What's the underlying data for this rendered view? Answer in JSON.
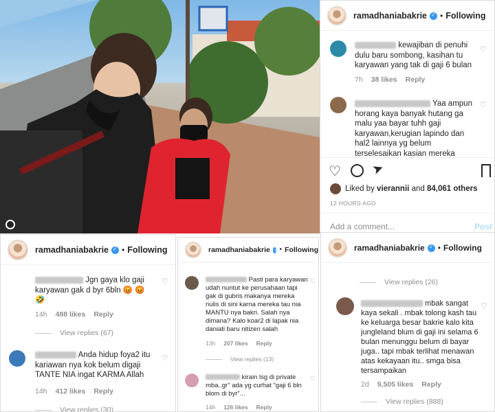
{
  "username": "ramadhaniabakrie",
  "follow_label": "Following",
  "separator": "•",
  "verified_icon": "verified-badge-icon",
  "main": {
    "comments": [
      {
        "text": "kewajiban di penuhi dulu baru sombong, kasihan tu karyawan yang tak di gaji 6 bulan",
        "time": "7h",
        "likes": "38 likes",
        "reply": "Reply"
      },
      {
        "text": "Yaa ampun horang kaya banyak hutang ga malu yaa bayar tuhh gaji karyawan,kerugian lapindo dan hal2 lainnya yg belum terselesaikan kasian mereka"
      }
    ],
    "liked_prefix": "Liked by",
    "liked_user": "vierannii",
    "liked_and": "and",
    "liked_count": "84,061 others",
    "timestamp": "12 HOURS AGO",
    "add_comment_placeholder": "Add a comment...",
    "post_label": "Post"
  },
  "panel_left": {
    "comments": [
      {
        "text": "Jgn gaya klo gaji karyawan gak d byr 6bln 😡",
        "time": "14h",
        "likes": "488 likes",
        "reply": "Reply",
        "view_replies": "View replies (67)"
      },
      {
        "text": "Anda hidup foya2 itu kariawan nya kok belum digaji TANTE NIA ingat KARMA Allah",
        "time": "14h",
        "likes": "412 likes",
        "reply": "Reply",
        "view_replies": "View replies (30)"
      }
    ]
  },
  "panel_mid": {
    "comments": [
      {
        "text": "Pasti para karyawan udah nuntut ke perusahaan tapi gak di gubris makanya mereka nulis di sini karna mereka tau nia MANTU nya bakri. Salah nya dimana? Kalo koar2 di lapak nia daniati baru nitizen salah",
        "time": "13h",
        "likes": "207 likes",
        "reply": "Reply",
        "view_replies": "View replies (13)"
      },
      {
        "text": "kirain lsg di private mba..gr\" ada yg curhat \"gaji 6 bln blom di byr\"...",
        "time": "14h",
        "likes": "126 likes",
        "reply": "Reply"
      }
    ]
  },
  "panel_right": {
    "top_view_replies": "View replies (26)",
    "comments": [
      {
        "text": "mbak sangat kaya sekali . mbak tolong kash tau ke keluarga besar bakrie kalo kita jungleland blum di gaji ini selama 6 bulan menunggu belum di bayar juga.. tapi mbak terlihat menawan atas kekayaan itu.. smga bisa tersampaikan",
        "time": "2d",
        "likes": "9,505 likes",
        "reply": "Reply",
        "view_replies": "View replies (888)"
      }
    ]
  }
}
